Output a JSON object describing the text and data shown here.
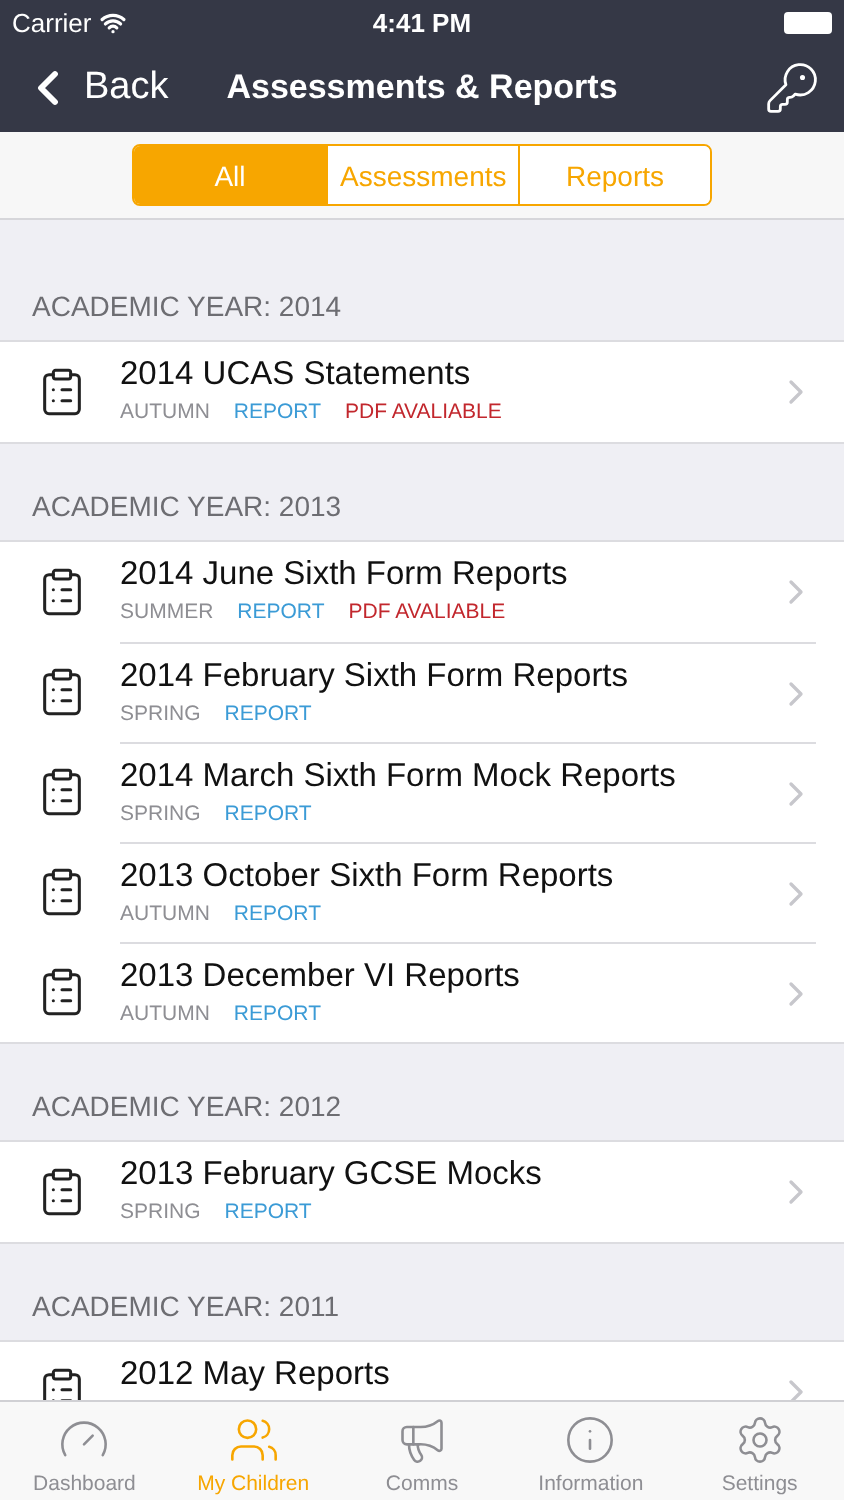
{
  "status_bar": {
    "carrier": "Carrier",
    "time": "4:41 PM"
  },
  "nav": {
    "back": "Back",
    "title": "Assessments & Reports"
  },
  "segments": [
    {
      "label": "All",
      "selected": true
    },
    {
      "label": "Assessments",
      "selected": false
    },
    {
      "label": "Reports",
      "selected": false
    }
  ],
  "sections": [
    {
      "header": "ACADEMIC YEAR: 2014",
      "rows": [
        {
          "title": "2014 UCAS Statements",
          "tags": [
            {
              "kind": "season",
              "text": "AUTUMN"
            },
            {
              "kind": "type",
              "text": "REPORT"
            },
            {
              "kind": "pdf",
              "text": "PDF AVALIABLE"
            }
          ]
        }
      ]
    },
    {
      "header": "ACADEMIC YEAR: 2013",
      "rows": [
        {
          "title": "2014 June Sixth Form Reports",
          "tags": [
            {
              "kind": "season",
              "text": "SUMMER"
            },
            {
              "kind": "type",
              "text": "REPORT"
            },
            {
              "kind": "pdf",
              "text": "PDF AVALIABLE"
            }
          ]
        },
        {
          "title": "2014 February Sixth Form Reports",
          "tags": [
            {
              "kind": "season",
              "text": "SPRING"
            },
            {
              "kind": "type",
              "text": "REPORT"
            }
          ]
        },
        {
          "title": "2014 March Sixth Form Mock Reports",
          "tags": [
            {
              "kind": "season",
              "text": "SPRING"
            },
            {
              "kind": "type",
              "text": "REPORT"
            }
          ]
        },
        {
          "title": "2013 October Sixth Form Reports",
          "tags": [
            {
              "kind": "season",
              "text": "AUTUMN"
            },
            {
              "kind": "type",
              "text": "REPORT"
            }
          ]
        },
        {
          "title": "2013 December VI Reports",
          "tags": [
            {
              "kind": "season",
              "text": "AUTUMN"
            },
            {
              "kind": "type",
              "text": "REPORT"
            }
          ]
        }
      ]
    },
    {
      "header": "ACADEMIC YEAR: 2012",
      "rows": [
        {
          "title": "2013 February GCSE Mocks",
          "tags": [
            {
              "kind": "season",
              "text": "SPRING"
            },
            {
              "kind": "type",
              "text": "REPORT"
            }
          ]
        }
      ]
    },
    {
      "header": "ACADEMIC YEAR: 2011",
      "rows": [
        {
          "title": "2012 May Reports",
          "tags": []
        }
      ]
    }
  ],
  "tab_bar": [
    {
      "kind": "dashboard",
      "label": "Dashboard",
      "selected": false
    },
    {
      "kind": "children",
      "label": "My Children",
      "selected": true
    },
    {
      "kind": "comms",
      "label": "Comms",
      "selected": false
    },
    {
      "kind": "information",
      "label": "Information",
      "selected": false
    },
    {
      "kind": "settings",
      "label": "Settings",
      "selected": false
    }
  ]
}
